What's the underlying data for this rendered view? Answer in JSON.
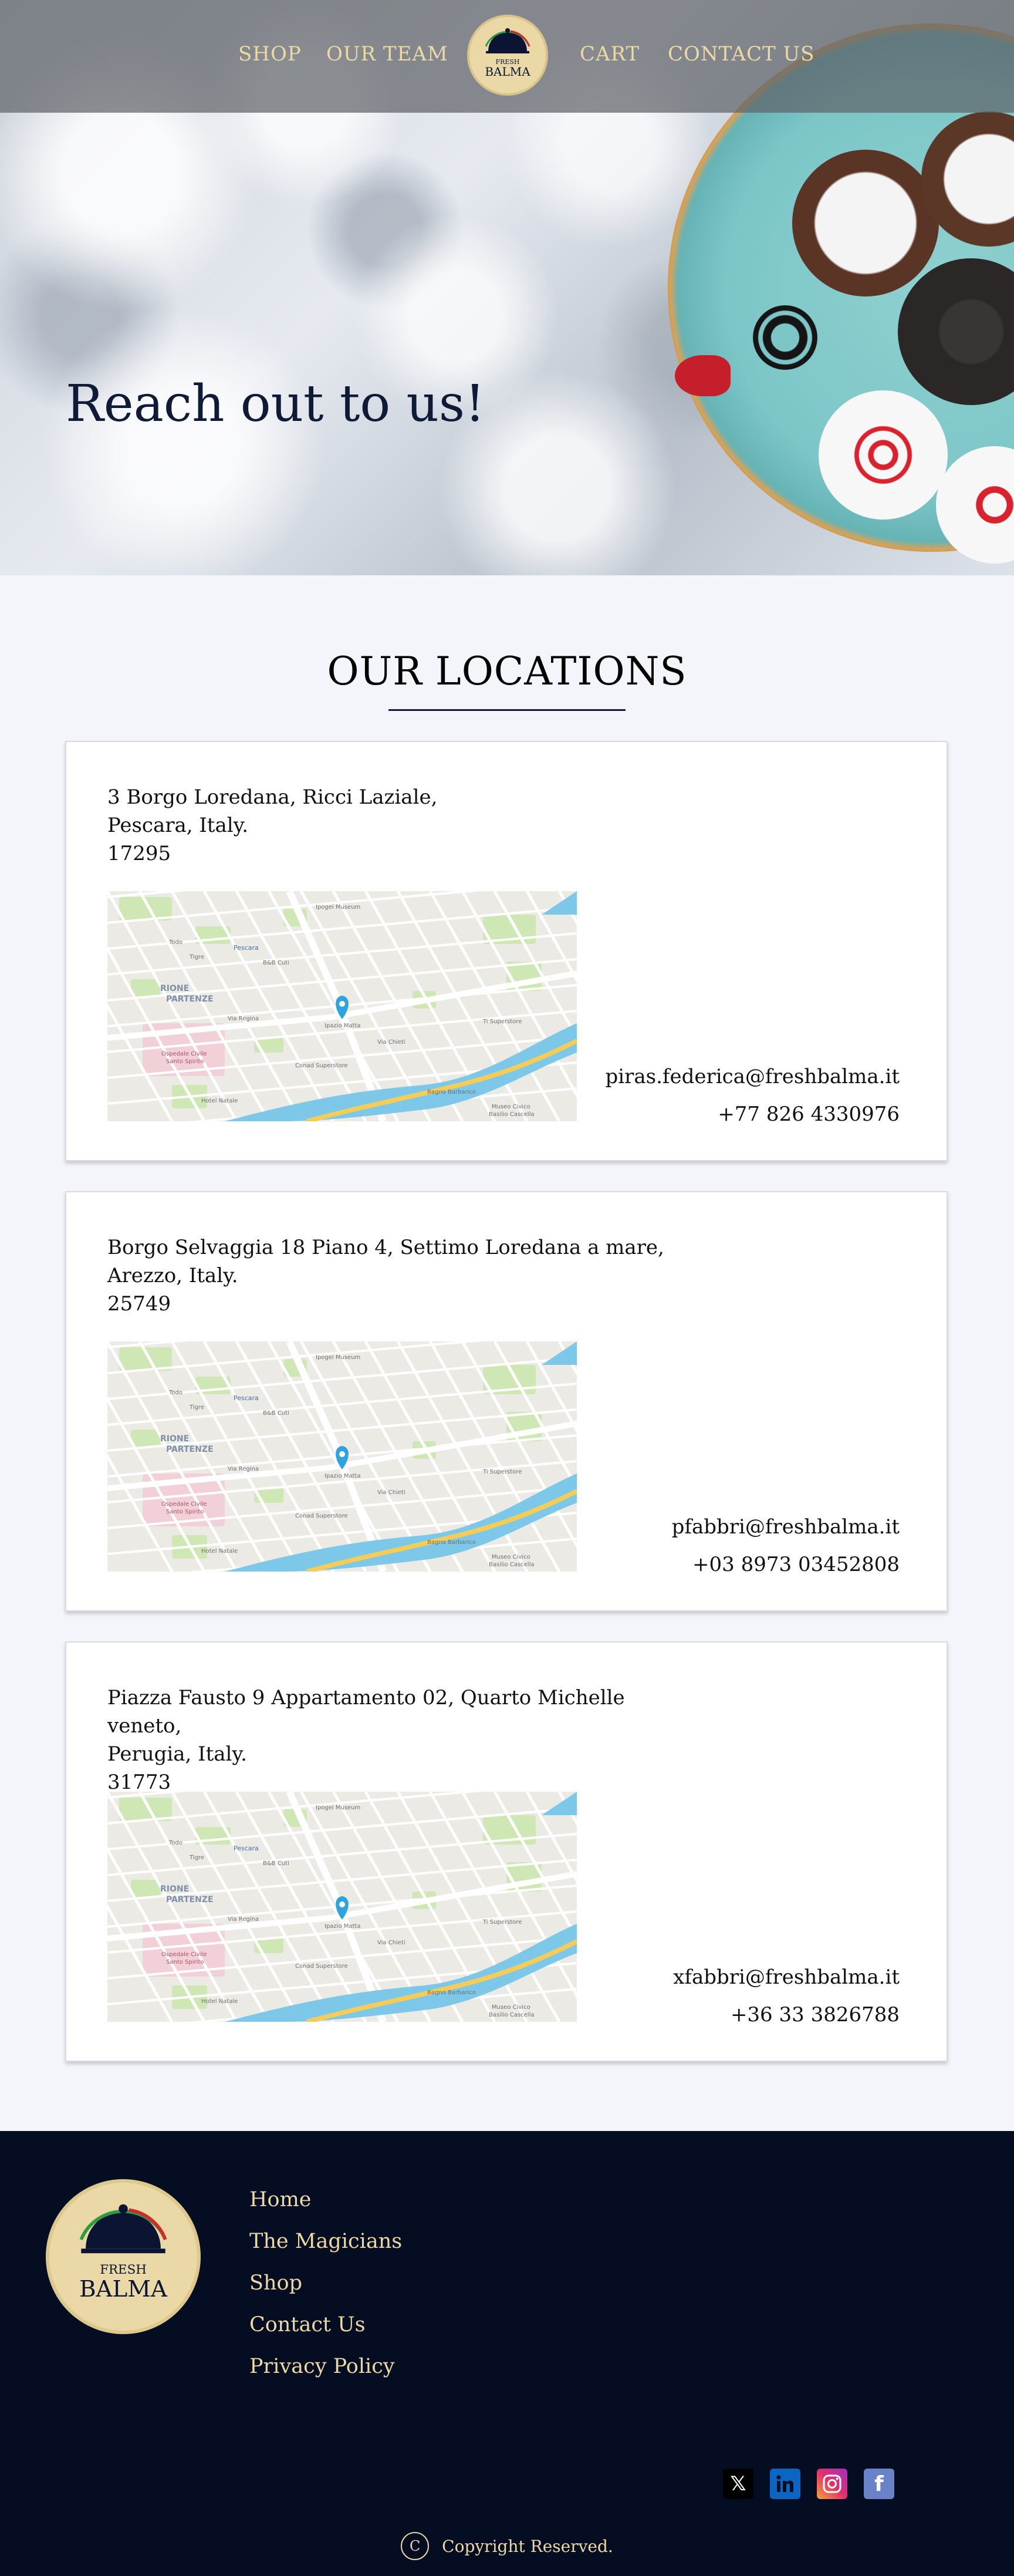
{
  "nav": {
    "shop": "SHOP",
    "our_team": "OUR TEAM",
    "cart": "CART",
    "contact_us": "CONTACT US"
  },
  "logo": {
    "line1": "FRESH",
    "line2": "BALMA"
  },
  "hero": {
    "title": "Reach out to us!"
  },
  "locations": {
    "title": "OUR LOCATIONS",
    "items": [
      {
        "address_line1": "3 Borgo Loredana, Ricci Laziale,",
        "address_line2": "Pescara, Italy.",
        "postal_code": "17295",
        "email": "piras.federica@freshbalma.it",
        "phone": "+77 826 4330976"
      },
      {
        "address_line1": "Borgo Selvaggia 18 Piano 4, Settimo Loredana a mare,",
        "address_line2": "Arezzo, Italy.",
        "postal_code": "25749",
        "email": "pfabbri@freshbalma.it",
        "phone": "+03 8973 03452808"
      },
      {
        "address_line1": "Piazza Fausto 9 Appartamento 02, Quarto Michelle veneto,",
        "address_line2": "Perugia, Italy.",
        "postal_code": "31773",
        "email": "xfabbri@freshbalma.it",
        "phone": "+36 33 3826788"
      }
    ]
  },
  "map_labels": {
    "museum": "Ipogei Museum",
    "district_1": "RIONE",
    "district_2": "PARTENZE",
    "hospital_1": "Ospedale Civile",
    "hospital_2": "Santo Spirito",
    "street_1": "Via Regina",
    "street_2": "Via Chieti",
    "station": "Pescara",
    "store": "Conad Superstore",
    "hotel": "Hotel Natale",
    "bar": "Bagno Barbarico",
    "museum_2": "Museo Civico",
    "museum_3": "Basilio Cascella",
    "square": "Ipazio Matta",
    "super": "Ti Superstore",
    "cafe": "B&B Cuti",
    "todo": "Todo",
    "tigre": "Tigre"
  },
  "footer": {
    "links": [
      "Home",
      "The Magicians",
      "Shop",
      "Contact Us",
      "Privacy Policy"
    ],
    "copyright": "Copyright Reserved.",
    "copyright_symbol": "C",
    "social_icons": [
      "x-icon",
      "linkedin-icon",
      "instagram-icon",
      "facebook-icon"
    ]
  },
  "colors": {
    "accent_gold": "#ecd9a4",
    "navy": "#050d22",
    "nav_overlay": "#5f6469",
    "logo_bg": "#ead9a7",
    "title_navy": "#0e1a36"
  }
}
